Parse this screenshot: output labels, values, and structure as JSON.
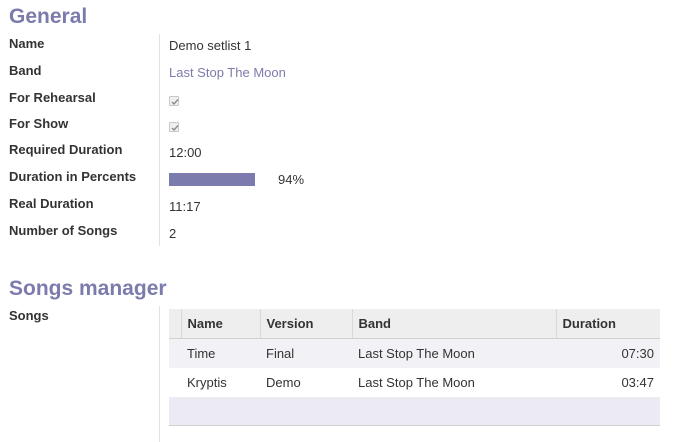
{
  "general": {
    "title": "General",
    "fields": {
      "name": {
        "label": "Name",
        "value": "Demo setlist 1"
      },
      "band": {
        "label": "Band",
        "value": "Last Stop The Moon"
      },
      "for_rehearsal": {
        "label": "For Rehearsal",
        "checked": true
      },
      "for_show": {
        "label": "For Show",
        "checked": true
      },
      "required_duration": {
        "label": "Required Duration",
        "value": "12:00"
      },
      "duration_percents": {
        "label": "Duration in Percents",
        "value": "94%",
        "fraction": 0.94
      },
      "real_duration": {
        "label": "Real Duration",
        "value": "11:17"
      },
      "number_of_songs": {
        "label": "Number of Songs",
        "value": "2"
      }
    }
  },
  "songs_manager": {
    "title": "Songs manager",
    "songs_label": "Songs",
    "columns": [
      "Name",
      "Version",
      "Band",
      "Duration"
    ],
    "rows": [
      {
        "name": "Time",
        "version": "Final",
        "band": "Last Stop The Moon",
        "duration": "07:30"
      },
      {
        "name": "Kryptis",
        "version": "Demo",
        "band": "Last Stop The Moon",
        "duration": "03:47"
      }
    ]
  },
  "colors": {
    "accent": "#7c7bad"
  }
}
